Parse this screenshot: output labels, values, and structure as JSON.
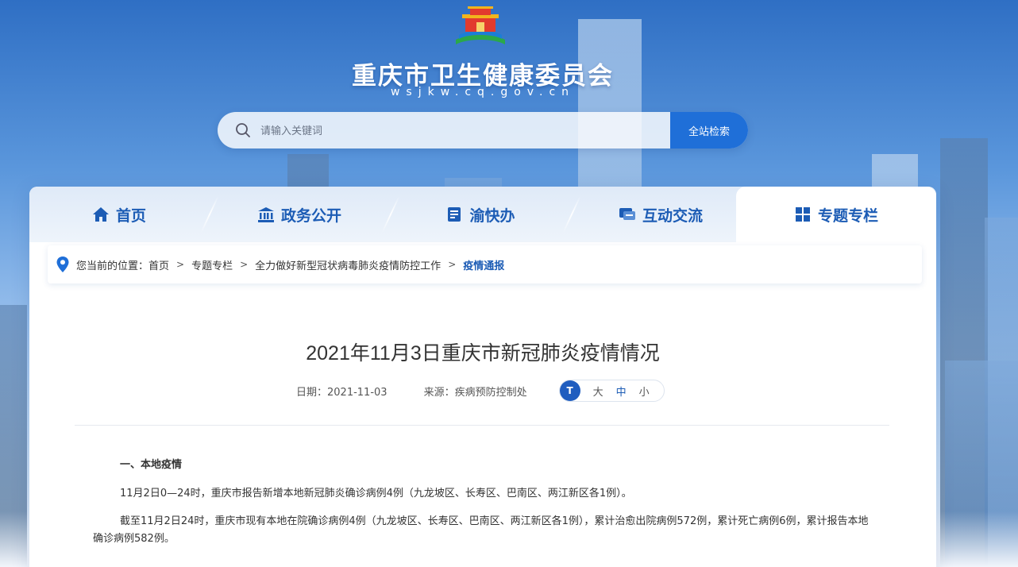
{
  "header": {
    "site_title": "重庆市卫生健康委员会",
    "site_domain": "wsjkw.cq.gov.cn",
    "logo_icon": "tiananmen-logo-icon"
  },
  "search": {
    "placeholder": "请输入关键词",
    "button_label": "全站检索",
    "icon": "search-icon"
  },
  "nav": {
    "tabs": [
      {
        "label": "首页",
        "icon": "home-icon"
      },
      {
        "label": "政务公开",
        "icon": "building-icon"
      },
      {
        "label": "渝快办",
        "icon": "document-icon"
      },
      {
        "label": "互动交流",
        "icon": "chat-icon"
      },
      {
        "label": "专题专栏",
        "icon": "grid-icon",
        "active": true
      }
    ]
  },
  "breadcrumb": {
    "prefix": "您当前的位置：",
    "items": [
      "首页",
      "专题专栏",
      "全力做好新型冠状病毒肺炎疫情防控工作",
      "疫情通报"
    ],
    "separator": ">"
  },
  "article": {
    "title": "2021年11月3日重庆市新冠肺炎疫情情况",
    "date": "日期：2021-11-03",
    "source": "来源：疾病预防控制处",
    "font_size": {
      "badge": "T",
      "large": "大",
      "medium": "中",
      "small": "小"
    },
    "section_heading": "一、本地疫情",
    "paragraphs": [
      "11月2日0—24时，重庆市报告新增本地新冠肺炎确诊病例4例（九龙坡区、长寿区、巴南区、两江新区各1例）。",
      "截至11月2日24时，重庆市现有本地在院确诊病例4例（九龙坡区、长寿区、巴南区、两江新区各1例），累计治愈出院病例572例，累计死亡病例6例，累计报告本地确诊病例582例。"
    ]
  },
  "colors": {
    "accent": "#1f6fd8",
    "nav_text": "#1c5cb5",
    "title_text": "#333333"
  }
}
